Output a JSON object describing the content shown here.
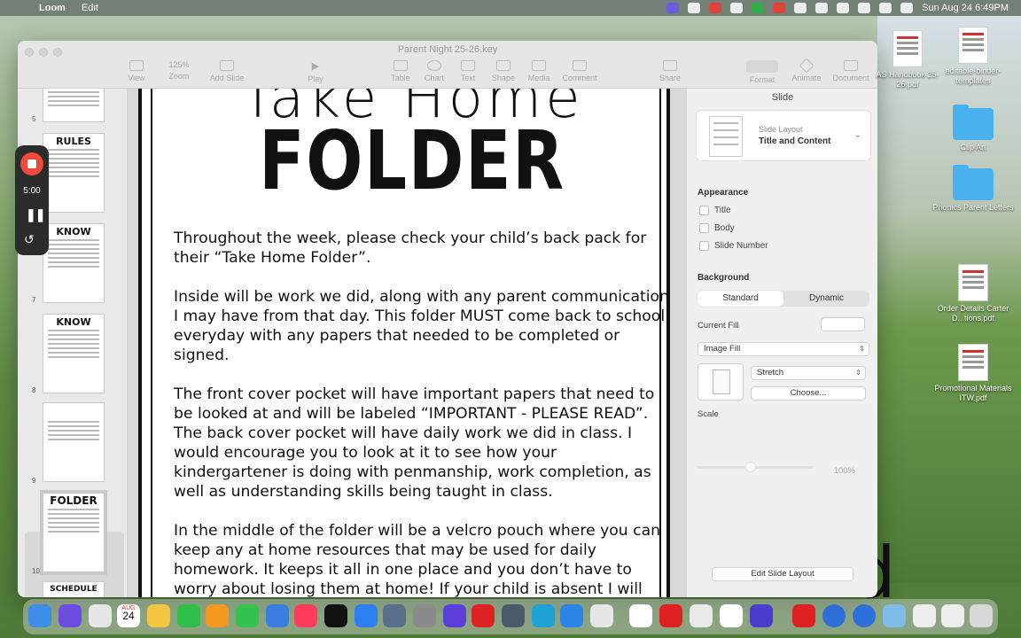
{
  "menubar": {
    "app_name": "Loom",
    "menu_edit": "Edit",
    "datetime": "Sun Aug 24  6:49PM"
  },
  "window": {
    "title": "Parent Night 25-26.key",
    "toolbar": {
      "view": "View",
      "zoom": "Zoom",
      "zoom_value": "125%",
      "add_slide": "Add Slide",
      "play": "Play",
      "table": "Table",
      "chart": "Chart",
      "text": "Text",
      "shape": "Shape",
      "media": "Media",
      "comment": "Comment",
      "share": "Share",
      "format": "Format",
      "animate": "Animate",
      "document": "Document"
    }
  },
  "navigator": {
    "slides": [
      {
        "number": "5",
        "heading": ""
      },
      {
        "number": "6",
        "heading": "RULES"
      },
      {
        "number": "7",
        "heading": "KNOW"
      },
      {
        "number": "8",
        "heading": "KNOW"
      },
      {
        "number": "9",
        "heading": ""
      },
      {
        "number": "10",
        "heading": "FOLDER"
      },
      {
        "number": "",
        "heading": "SCHEDULE"
      }
    ]
  },
  "slide": {
    "title_top": "Take Home",
    "title": "FOLDER",
    "paragraphs": [
      "Throughout the week, please check your child’s back pack for their “Take Home Folder”.",
      "Inside will be work we did, along with any parent communication I may have from that day. This folder MUST come back to school everyday with any papers that needed to be completed or signed.",
      "The front cover pocket will have important papers that need to be looked at and will be labeled “IMPORTANT - PLEASE READ”.  The back cover pocket will have daily work we did in class.  I would encourage you to look at it to see how your kindergartener is doing with penmanship, work completion, as well as understanding skills being taught in class.",
      "In the middle of the folder will be a velcro pouch where you can keep any at home resources that may be used for daily homework.  It keeps it all in one place and you don’t have to worry about losing them at home! If your child is absent I will"
    ]
  },
  "inspector": {
    "tab": "Slide",
    "layout_label": "Slide Layout",
    "layout_value": "Title and Content",
    "appearance": "Appearance",
    "cb_title": "Title",
    "cb_body": "Body",
    "cb_slide_number": "Slide Number",
    "background": "Background",
    "seg_standard": "Standard",
    "seg_dynamic": "Dynamic",
    "current_fill": "Current Fill",
    "fill_type": "Image Fill",
    "scale_mode": "Stretch",
    "choose": "Choose...",
    "scale": "Scale",
    "scale_value": "100%",
    "edit_layout": "Edit Slide Layout"
  },
  "loom": {
    "timer": "5:00"
  },
  "desktop": {
    "items": [
      {
        "label": "AS Handbook 25-26.pdf",
        "kind": "pdf"
      },
      {
        "label": "editable-binder-templates",
        "kind": "pdf"
      },
      {
        "label": "Clip Art",
        "kind": "folder"
      },
      {
        "label": "Phonics Parent Letters",
        "kind": "folder"
      },
      {
        "label": "Order Details Carter D...tions.pdf",
        "kind": "pdf"
      },
      {
        "label": "Promotional Materials ITW.pdf",
        "kind": "pdf"
      }
    ]
  },
  "dock": {
    "calendar_month": "AUG",
    "calendar_day": "24"
  },
  "colors": {
    "accent": "#f04a3c",
    "folder": "#49b1ee"
  }
}
